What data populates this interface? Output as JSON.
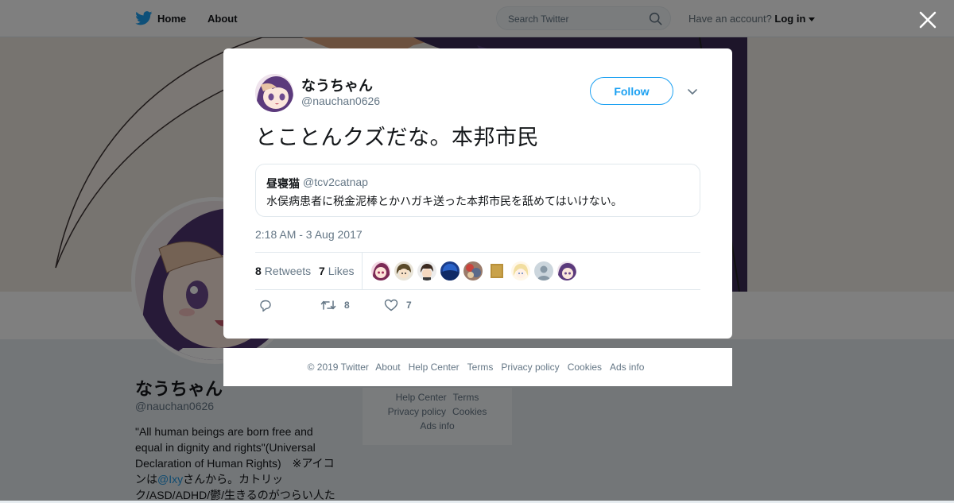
{
  "colors": {
    "brand": "#1da1f2",
    "link": "#1b95e0",
    "text": "#14171a",
    "muted": "#657786"
  },
  "topbar": {
    "home_label": "Home",
    "about_label": "About",
    "search_placeholder": "Search Twitter",
    "have_account": "Have an account?",
    "login_label": "Log in"
  },
  "profile": {
    "name": "なうちゃん",
    "handle": "@nauchan0626",
    "bio_1": "\"All human beings are born free and equal in dignity and rights\"(Universal Declaration of Human Rights)　※アイコンは",
    "bio_mention": "@Ixy",
    "bio_2": "さんから。カトリック/ASD/ADHD/鬱/生きるのがつらい人た",
    "footer_links": [
      "Help Center",
      "Terms",
      "Privacy policy",
      "Cookies",
      "Ads info"
    ]
  },
  "tweet": {
    "author_name": "なうちゃん",
    "author_handle": "@nauchan0626",
    "follow_label": "Follow",
    "text": "とことんクズだな。本邦市民",
    "quote": {
      "name": "昼寝猫",
      "handle": "@tcv2catnap",
      "text": "水俣病患者に税金泥棒とかハガキ送った本邦市民を舐めてはいけない。"
    },
    "timestamp": "2:18 AM - 3 Aug 2017",
    "retweets_count": "8",
    "retweets_label": "Retweets",
    "likes_count": "7",
    "likes_label": "Likes",
    "action_retweet_count": "8",
    "action_like_count": "7"
  },
  "footer": {
    "copyright": "© 2019 Twitter",
    "links": [
      "About",
      "Help Center",
      "Terms",
      "Privacy policy",
      "Cookies",
      "Ads info"
    ]
  },
  "icons": [
    "twitter-bird-icon",
    "search-icon",
    "caret-down-icon",
    "close-icon",
    "chevron-down-icon",
    "reply-icon",
    "retweet-icon",
    "heart-icon"
  ]
}
